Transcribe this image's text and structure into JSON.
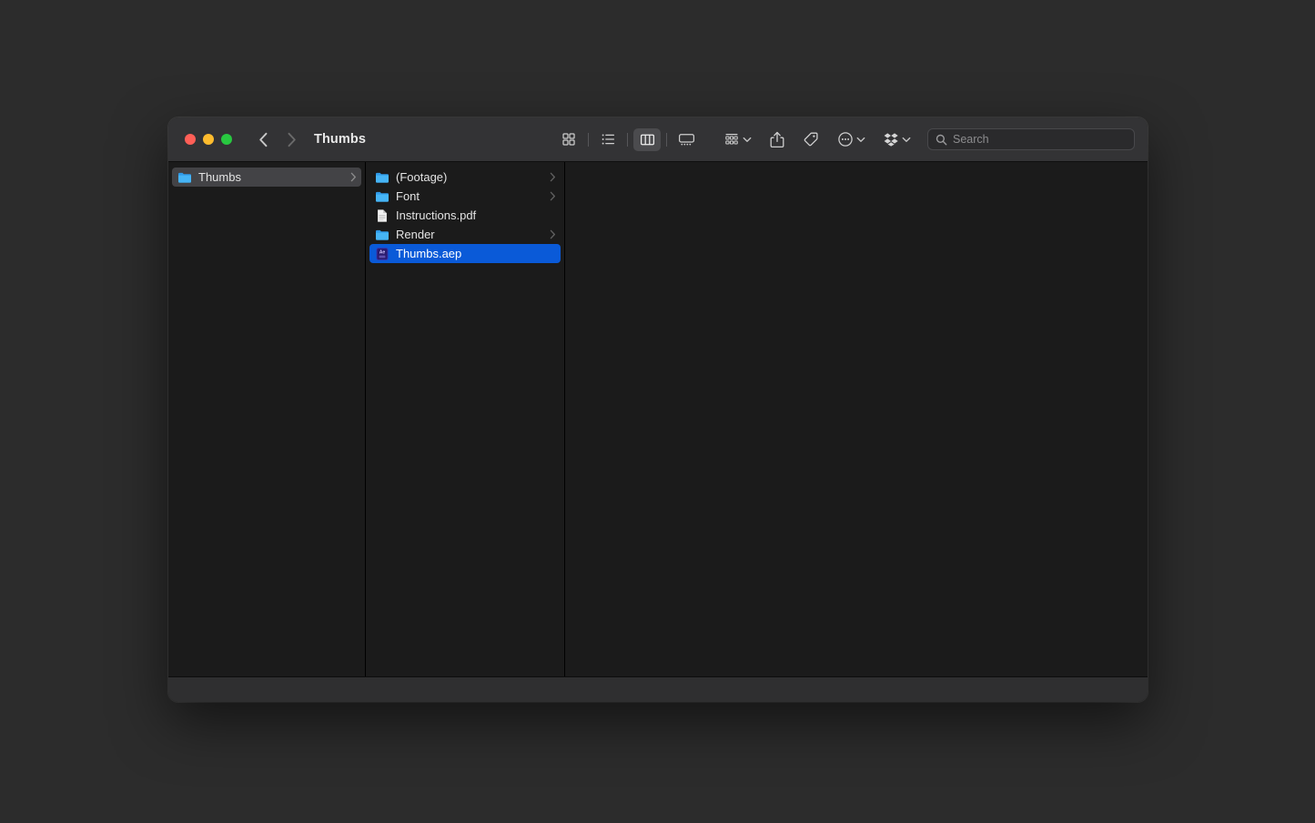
{
  "window": {
    "title": "Thumbs",
    "traffic_lights": [
      {
        "name": "close",
        "color": "#ff5f57"
      },
      {
        "name": "minimize",
        "color": "#febc2e"
      },
      {
        "name": "zoom",
        "color": "#28c840"
      }
    ],
    "nav": {
      "back_label": "Back",
      "forward_label": "Forward"
    }
  },
  "toolbar": {
    "view_modes": [
      {
        "id": "icon",
        "label": "Icon View",
        "active": false
      },
      {
        "id": "list",
        "label": "List View",
        "active": false
      },
      {
        "id": "column",
        "label": "Column View",
        "active": true
      },
      {
        "id": "gallery",
        "label": "Gallery View",
        "active": false
      }
    ],
    "group_label": "Group",
    "share_label": "Share",
    "tags_label": "Tags",
    "actions_label": "Actions",
    "dropbox_label": "Dropbox"
  },
  "search": {
    "placeholder": "Search",
    "value": ""
  },
  "columns": [
    {
      "id": "column-1",
      "items": [
        {
          "name": "Thumbs",
          "kind": "folder",
          "has_chevron": true,
          "state": "selected-inactive"
        }
      ]
    },
    {
      "id": "column-2",
      "items": [
        {
          "name": "(Footage)",
          "kind": "folder",
          "has_chevron": true,
          "state": "normal"
        },
        {
          "name": "Font",
          "kind": "folder",
          "has_chevron": true,
          "state": "normal"
        },
        {
          "name": "Instructions.pdf",
          "kind": "pdf",
          "has_chevron": false,
          "state": "normal"
        },
        {
          "name": "Render",
          "kind": "folder",
          "has_chevron": true,
          "state": "normal"
        },
        {
          "name": "Thumbs.aep",
          "kind": "after-effects",
          "has_chevron": false,
          "state": "selected-active"
        }
      ]
    },
    {
      "id": "column-3",
      "items": []
    }
  ],
  "colors": {
    "accent_selection": "#0a5ad8",
    "inactive_selection": "#434346",
    "folder_blue": "#3aa9f2",
    "titlebar": "#333335",
    "column_background": "#1b1b1b",
    "window_background": "#1c1c1c",
    "desktop": "#2c2c2c"
  }
}
